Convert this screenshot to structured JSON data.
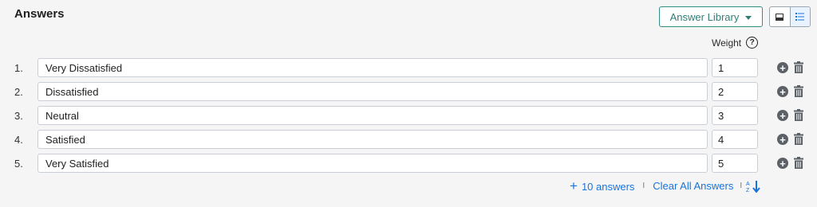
{
  "section": {
    "title": "Answers"
  },
  "toolbar": {
    "library_label": "Answer Library",
    "icons": [
      "single-view-icon",
      "list-view-icon"
    ]
  },
  "weight_header": {
    "label": "Weight",
    "help_glyph": "?"
  },
  "answers": [
    {
      "number": "1.",
      "text": "Very Dissatisfied",
      "weight": "1"
    },
    {
      "number": "2.",
      "text": "Dissatisfied",
      "weight": "2"
    },
    {
      "number": "3.",
      "text": "Neutral",
      "weight": "3"
    },
    {
      "number": "4.",
      "text": "Satisfied",
      "weight": "4"
    },
    {
      "number": "5.",
      "text": "Very Satisfied",
      "weight": "5"
    }
  ],
  "footer": {
    "add_label": "10 answers",
    "separator": "I",
    "clear_label": "Clear All Answers",
    "sort_icon": "sort-alpha-icon"
  },
  "colors": {
    "accent": "#2f7f75",
    "link": "#1a73d9",
    "icon": "#5b6166"
  }
}
